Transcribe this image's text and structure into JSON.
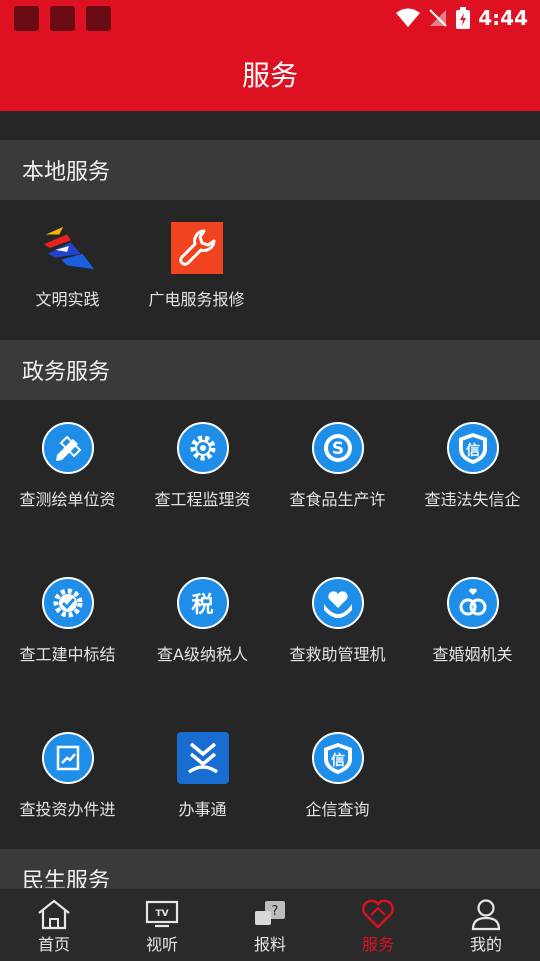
{
  "status": {
    "time": "4:44"
  },
  "header": {
    "title": "服务"
  },
  "sections": [
    {
      "title": "本地服务",
      "items": [
        {
          "label": "文明实践",
          "icon": "civilization-practice-logo-icon"
        },
        {
          "label": "广电服务报修",
          "icon": "wrench-repair-icon"
        }
      ]
    },
    {
      "title": "政务服务",
      "items": [
        {
          "label": "查测绘单位资",
          "icon": "pencil-ruler-icon"
        },
        {
          "label": "查工程监理资",
          "icon": "gear-icon"
        },
        {
          "label": "查食品生产许",
          "icon": "food-s-icon"
        },
        {
          "label": "查违法失信企",
          "icon": "credit-shield-icon",
          "glyph": "信"
        },
        {
          "label": "查工建中标结",
          "icon": "gear-check-icon"
        },
        {
          "label": "查A级纳税人",
          "icon": "tax-icon",
          "glyph": "税"
        },
        {
          "label": "查救助管理机",
          "icon": "heart-hands-icon"
        },
        {
          "label": "查婚姻机关",
          "icon": "rings-icon"
        },
        {
          "label": "查投资办件进",
          "icon": "chart-doc-icon"
        },
        {
          "label": "办事通",
          "icon": "banshitong-logo-icon"
        },
        {
          "label": "企信查询",
          "icon": "credit-shield-icon",
          "glyph": "信"
        }
      ]
    },
    {
      "title": "民生服务",
      "items": []
    }
  ],
  "tabs": [
    {
      "label": "首页",
      "icon": "home-icon",
      "active": false
    },
    {
      "label": "视听",
      "icon": "tv-icon",
      "active": false
    },
    {
      "label": "报料",
      "icon": "report-chat-icon",
      "active": false
    },
    {
      "label": "服务",
      "icon": "heart-icon",
      "active": true
    },
    {
      "label": "我的",
      "icon": "person-icon",
      "active": false
    }
  ],
  "colors": {
    "brand": "#dd1122",
    "icon_blue": "#1e8ee8",
    "background": "#262626",
    "section_header": "#3a3a3a"
  }
}
